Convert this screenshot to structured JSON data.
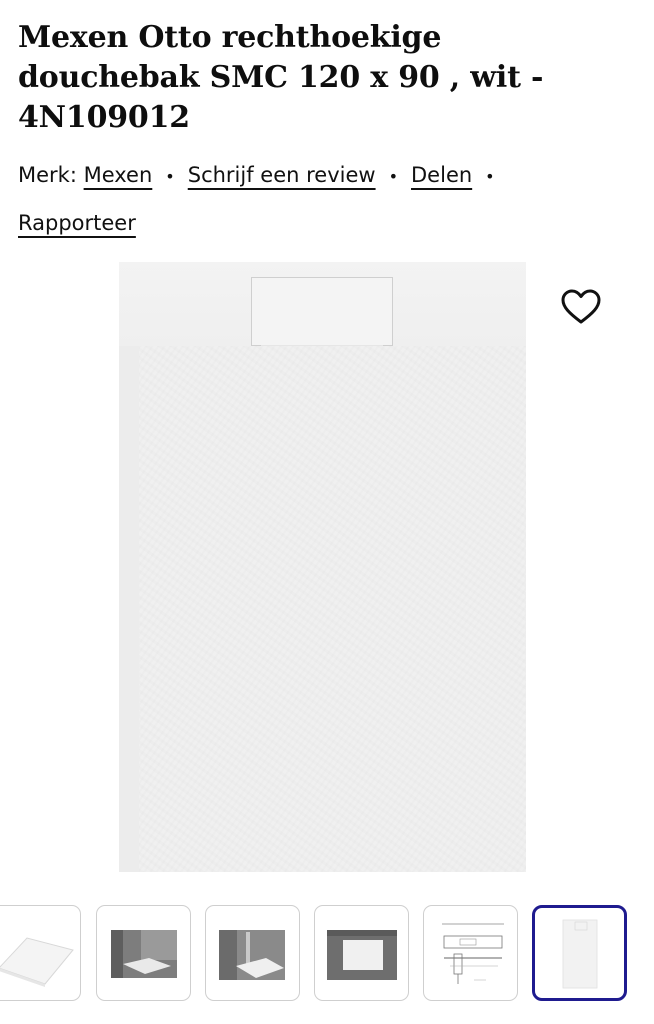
{
  "product": {
    "title_line1": "Mexen Otto rechthoekige",
    "title_line2": "douchebak SMC 120 x 90 , wit -",
    "title_line3": "4N109012"
  },
  "meta": {
    "brand_label": "Merk:",
    "brand_link": "Mexen",
    "review_link": "Schrijf een review",
    "share_link": "Delen",
    "report_link": "Rapporteer",
    "separator": "•"
  },
  "image": {
    "alt": "Mexen Otto rechthoekige douchebak SMC 120 x 90 , wit - 4N109012"
  },
  "wishlist": {
    "icon": "heart-outline-icon"
  },
  "thumbnails": {
    "count": 6,
    "selected_index": 5,
    "accent_color": "#1f1b8f"
  }
}
